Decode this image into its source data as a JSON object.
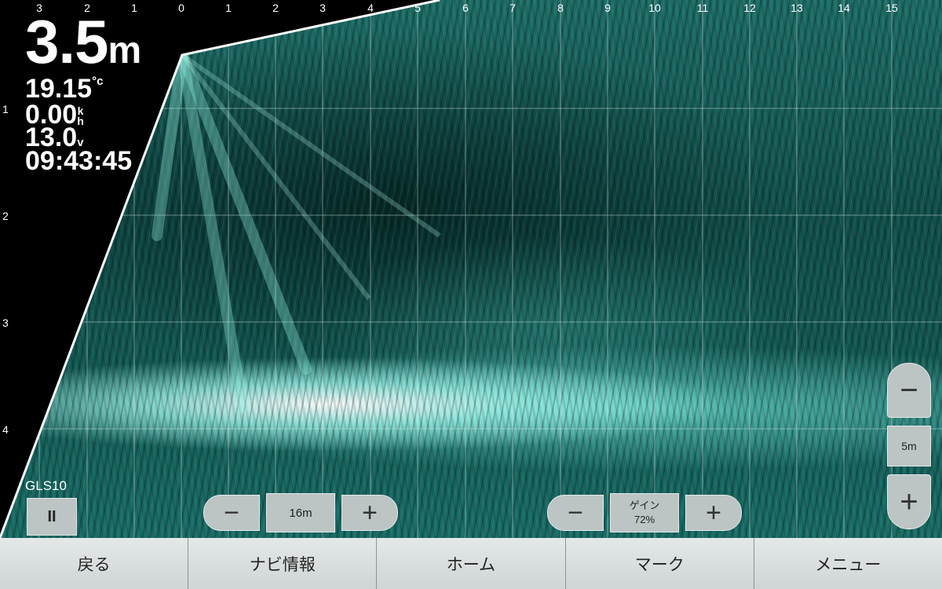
{
  "sonar": {
    "x_ticks": [
      "3",
      "2",
      "1",
      "0",
      "1",
      "2",
      "3",
      "4",
      "5",
      "6",
      "7",
      "8",
      "9",
      "10",
      "11",
      "12",
      "13",
      "14",
      "15"
    ],
    "y_ticks": [
      "1",
      "2",
      "3",
      "4"
    ]
  },
  "readouts": {
    "depth_value": "3.5",
    "depth_unit": "m",
    "water_temp_value": "19.15",
    "water_temp_unit": "°c",
    "speed_value": "0.00",
    "speed_unit_top": "k",
    "speed_unit_bottom": "h",
    "voltage_value": "13.0",
    "voltage_unit": "v",
    "time": "09:43:45"
  },
  "source": {
    "label": "GLS10",
    "pause_label": "II"
  },
  "range_control": {
    "minus": "−",
    "value": "16m",
    "plus": "+"
  },
  "gain_control": {
    "minus": "−",
    "label": "ゲイン",
    "value": "72%",
    "plus": "+"
  },
  "zoom_control": {
    "minus": "−",
    "value": "5m",
    "plus": "+"
  },
  "bottom_nav": {
    "back": "戻る",
    "navi_info": "ナビ情報",
    "home": "ホーム",
    "mark": "マーク",
    "menu": "メニュー"
  },
  "colors": {
    "sonar_accent": "#2fb3a6",
    "button_face": "#bcc4c4"
  }
}
